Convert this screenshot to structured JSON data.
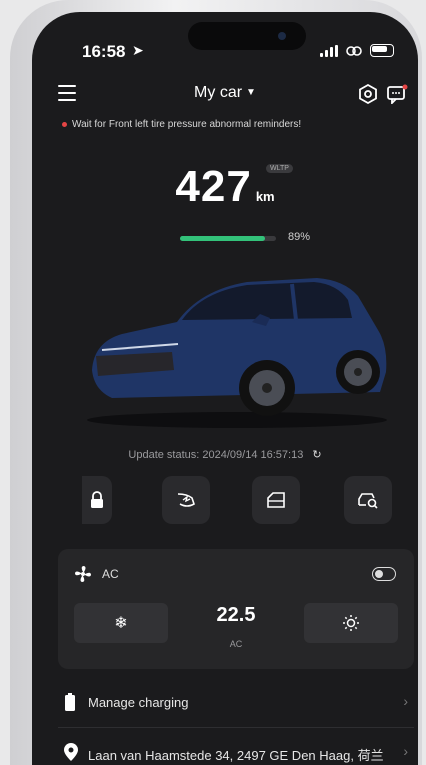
{
  "status_bar": {
    "time": "16:58"
  },
  "nav": {
    "title": "My car"
  },
  "warning": {
    "text": "Wait for Front left tire pressure abnormal reminders!"
  },
  "range": {
    "value": "427",
    "unit": "km",
    "standard": "WLTP"
  },
  "battery": {
    "percent_label": "89%",
    "level": 0.89
  },
  "update": {
    "label": "Update status:",
    "timestamp": "2024/09/14 16:57:13"
  },
  "quick_actions": [
    {
      "name": "lock",
      "icon": "lock-icon"
    },
    {
      "name": "charge-port",
      "icon": "charge-port-icon"
    },
    {
      "name": "trunk",
      "icon": "trunk-icon"
    },
    {
      "name": "find-car",
      "icon": "find-car-icon"
    }
  ],
  "ac": {
    "title": "AC",
    "temperature": "22.5",
    "mode": "AC"
  },
  "list": {
    "charging": "Manage charging",
    "location": "Laan van Haamstede 34, 2497 GE Den Haag, 荷兰"
  },
  "colors": {
    "battery_fill": "#33c27a",
    "warning_dot": "#e54545",
    "background": "#1b1b1d"
  }
}
